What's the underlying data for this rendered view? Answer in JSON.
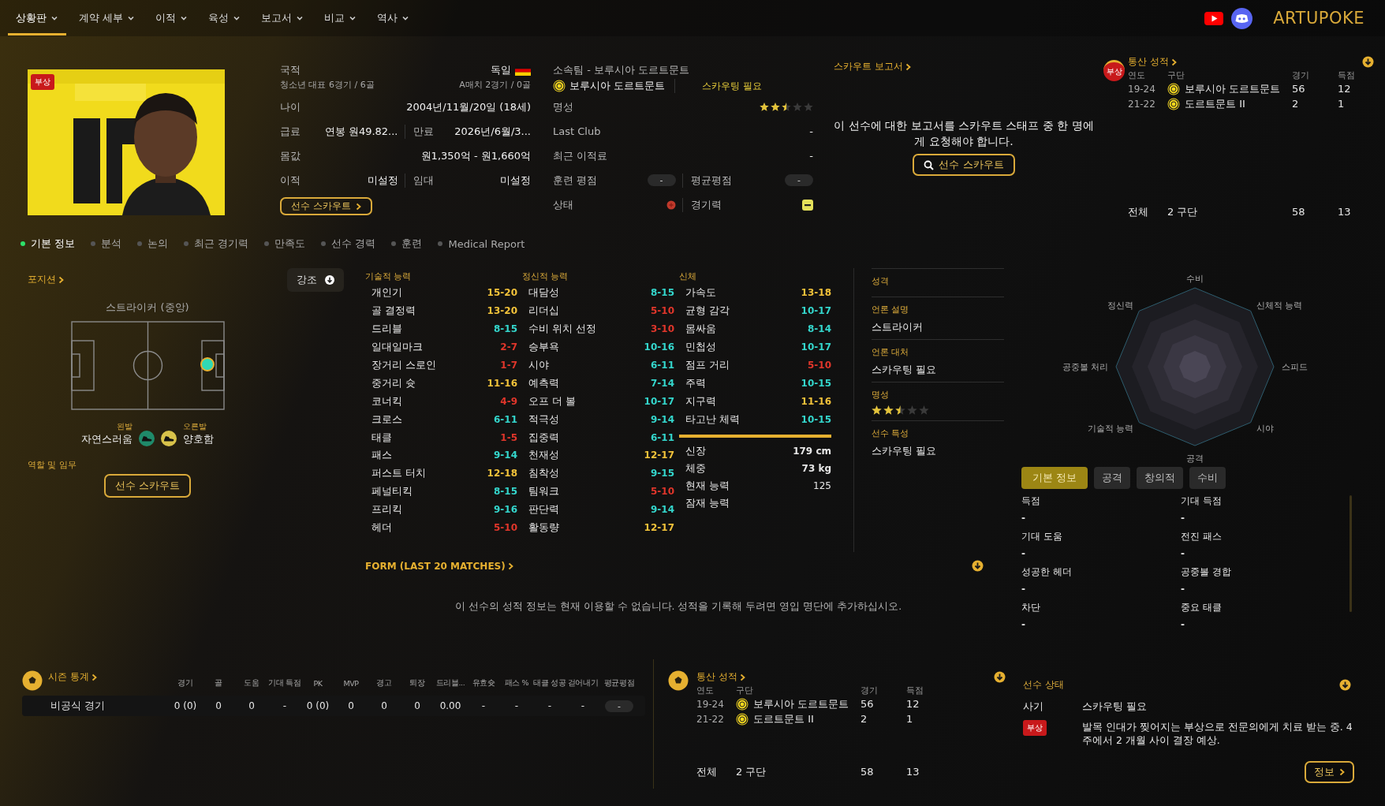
{
  "nav": {
    "items": [
      {
        "label": "상황판",
        "selected": true
      },
      {
        "label": "계약 세부",
        "selected": false
      },
      {
        "label": "이적",
        "selected": false
      },
      {
        "label": "육성",
        "selected": false
      },
      {
        "label": "보고서",
        "selected": false
      },
      {
        "label": "비교",
        "selected": false
      },
      {
        "label": "역사",
        "selected": false
      }
    ],
    "brand": "ARTUPOKE"
  },
  "photo": {
    "kind": "picture",
    "badge": "부상"
  },
  "nationality": {
    "label": "국적",
    "value": "독일",
    "youth": "청소년 대표 6경기 / 6골",
    "senior": "A매치 2경기 / 0골"
  },
  "info_left": [
    {
      "label": "나이",
      "value": "2004년/11월/20일 (18세)"
    },
    {
      "label": "급료",
      "value": "연봉 원49.82...",
      "label2": "만료",
      "value2": "2026년/6월/3..."
    },
    {
      "label": "몸값",
      "value": "원1,350억 - 원1,660억"
    },
    {
      "label": "이적",
      "value": "미설정",
      "label2": "임대",
      "value2": "미설정"
    }
  ],
  "scout_button": "선수 스카우트",
  "club": {
    "label": "소속팀 - 보루시아 도르트문트",
    "name": "보루시아 도르트문트",
    "note": "스카우팅 필요"
  },
  "info_right": [
    {
      "kind": "stars",
      "label": "명성",
      "stars": 2.5
    },
    {
      "kind": "text",
      "label": "Last Club",
      "value": "-"
    },
    {
      "kind": "text",
      "label": "최근 이적료",
      "value": "-"
    },
    {
      "kind": "pills",
      "label": "훈련 평점",
      "value": "-",
      "label2": "평균평점",
      "value2": "-"
    },
    {
      "kind": "status",
      "label": "상태",
      "label2": "경기력"
    }
  ],
  "scout_report": {
    "title": "스카우트 보고서",
    "message": "이 선수에 대한 보고서를 스카우트 스태프 중 한 명에게 요청해야 합니다.",
    "button": "선수 스카우트"
  },
  "career_top": {
    "badge": "부상",
    "title": "통산 성적",
    "columns": [
      "연도",
      "구단",
      "경기",
      "득점"
    ],
    "rows": [
      {
        "year": "19-24",
        "club": "보루시아 도르트문트",
        "apps": "56",
        "goals": "12"
      },
      {
        "year": "21-22",
        "club": "도르트문트 II",
        "apps": "2",
        "goals": "1"
      }
    ],
    "total": {
      "label": "전체",
      "clubs": "2 구단",
      "apps": "58",
      "goals": "13"
    }
  },
  "tabs": [
    {
      "label": "기본 정보",
      "selected": true
    },
    {
      "label": "분석",
      "selected": false
    },
    {
      "label": "논의",
      "selected": false
    },
    {
      "label": "최근 경기력",
      "selected": false
    },
    {
      "label": "만족도",
      "selected": false
    },
    {
      "label": "선수 경력",
      "selected": false
    },
    {
      "label": "훈련",
      "selected": false
    },
    {
      "label": "Medical Report",
      "selected": false
    }
  ],
  "position": {
    "title": "포지션",
    "role": "스트라이커 (중앙)",
    "left_foot_label": "왼발",
    "left_foot": "자연스러움",
    "right_foot_label": "오른발",
    "right_foot": "양호함",
    "duties": "역할 및 임무",
    "button": "선수 스카우트"
  },
  "attributes": {
    "highlight": "강조",
    "groups": [
      {
        "title": "기술적 능력",
        "items": [
          {
            "name": "개인기",
            "range": "15-20",
            "color": "#f2c23a"
          },
          {
            "name": "골 결정력",
            "range": "13-20",
            "color": "#f2c23a"
          },
          {
            "name": "드리블",
            "range": "8-15",
            "color": "#34d6cc"
          },
          {
            "name": "일대일마크",
            "range": "2-7",
            "color": "#e0362b"
          },
          {
            "name": "장거리 스로인",
            "range": "1-7",
            "color": "#e0362b"
          },
          {
            "name": "중거리 슛",
            "range": "11-16",
            "color": "#f2c23a"
          },
          {
            "name": "코너킥",
            "range": "4-9",
            "color": "#e0362b"
          },
          {
            "name": "크로스",
            "range": "6-11",
            "color": "#34d6cc"
          },
          {
            "name": "태클",
            "range": "1-5",
            "color": "#e0362b"
          },
          {
            "name": "패스",
            "range": "9-14",
            "color": "#34d6cc"
          },
          {
            "name": "퍼스트 터치",
            "range": "12-18",
            "color": "#f2c23a"
          },
          {
            "name": "페널티킥",
            "range": "8-15",
            "color": "#34d6cc"
          },
          {
            "name": "프리킥",
            "range": "9-16",
            "color": "#34d6cc"
          },
          {
            "name": "헤더",
            "range": "5-10",
            "color": "#e0362b"
          }
        ]
      },
      {
        "title": "정신적 능력",
        "items": [
          {
            "name": "대담성",
            "range": "8-15",
            "color": "#34d6cc"
          },
          {
            "name": "리더십",
            "range": "5-10",
            "color": "#e0362b"
          },
          {
            "name": "수비 위치 선정",
            "range": "3-10",
            "color": "#e0362b"
          },
          {
            "name": "승부욕",
            "range": "10-16",
            "color": "#34d6cc"
          },
          {
            "name": "시야",
            "range": "6-11",
            "color": "#34d6cc"
          },
          {
            "name": "예측력",
            "range": "7-14",
            "color": "#34d6cc"
          },
          {
            "name": "오프 더 볼",
            "range": "10-17",
            "color": "#34d6cc"
          },
          {
            "name": "적극성",
            "range": "9-14",
            "color": "#34d6cc"
          },
          {
            "name": "집중력",
            "range": "6-11",
            "color": "#34d6cc"
          },
          {
            "name": "천재성",
            "range": "12-17",
            "color": "#f2c23a"
          },
          {
            "name": "침착성",
            "range": "9-15",
            "color": "#34d6cc"
          },
          {
            "name": "팀워크",
            "range": "5-10",
            "color": "#e0362b"
          },
          {
            "name": "판단력",
            "range": "9-14",
            "color": "#34d6cc"
          },
          {
            "name": "활동량",
            "range": "12-17",
            "color": "#f2c23a"
          }
        ]
      },
      {
        "title": "신체",
        "items": [
          {
            "name": "가속도",
            "range": "13-18",
            "color": "#f2c23a"
          },
          {
            "name": "균형 감각",
            "range": "10-17",
            "color": "#34d6cc"
          },
          {
            "name": "몸싸움",
            "range": "8-14",
            "color": "#34d6cc"
          },
          {
            "name": "민첩성",
            "range": "10-17",
            "color": "#34d6cc"
          },
          {
            "name": "점프 거리",
            "range": "5-10",
            "color": "#e0362b"
          },
          {
            "name": "주력",
            "range": "10-15",
            "color": "#34d6cc"
          },
          {
            "name": "지구력",
            "range": "11-16",
            "color": "#f2c23a"
          },
          {
            "name": "타고난 체력",
            "range": "10-15",
            "color": "#34d6cc"
          }
        ]
      }
    ],
    "body": [
      {
        "label": "신장",
        "value": "179 cm",
        "bold": true
      },
      {
        "label": "체중",
        "value": "73 kg",
        "bold": true
      },
      {
        "label": "현재 능력",
        "value": "125",
        "bold": false
      },
      {
        "label": "잠재 능력"
      }
    ]
  },
  "personality": [
    {
      "title": "성격"
    },
    {
      "title": "언론 설명",
      "value": "스트라이커"
    },
    {
      "title": "언론 대처",
      "value": "스카우팅 필요"
    },
    {
      "title": "명성",
      "stars": 2.5
    },
    {
      "title": "선수 특성",
      "value": "스카우팅 필요"
    }
  ],
  "radar": {
    "labels": [
      "수비",
      "신체적 능력",
      "스피드",
      "시야",
      "공격",
      "기술적 능력",
      "공중볼 처리",
      "정신력"
    ]
  },
  "stat_tabs": [
    {
      "label": "기본 정보",
      "selected": true
    },
    {
      "label": "공격",
      "selected": false
    },
    {
      "label": "창의적",
      "selected": false
    },
    {
      "label": "수비",
      "selected": false
    }
  ],
  "stats": [
    {
      "label": "득점",
      "value": "-"
    },
    {
      "label": "기대 득점",
      "value": "-"
    },
    {
      "label": "기대 도움",
      "value": "-"
    },
    {
      "label": "전진 패스",
      "value": "-"
    },
    {
      "label": "성공한 헤더",
      "value": "-"
    },
    {
      "label": "공중볼 경합",
      "value": "-"
    },
    {
      "label": "차단",
      "value": "-"
    },
    {
      "label": "중요 태클",
      "value": "-"
    }
  ],
  "form": {
    "title": "FORM (LAST 20 MATCHES)",
    "message": "이 선수의 성적 정보는 현재 이용할 수 없습니다. 성적을 기록해 두려면 영입 명단에 추가하십시오."
  },
  "season_stats": {
    "title": "시즌 통계",
    "columns": [
      "경기",
      "골",
      "도움",
      "기대 득점",
      "PK",
      "MVP",
      "경고",
      "퇴장",
      "드리블...",
      "유효슛",
      "패스 %",
      "태클 성공",
      "걷어내기",
      "평균평점"
    ],
    "rows": [
      {
        "competition": "비공식 경기",
        "cells": [
          "0 (0)",
          "0",
          "0",
          "-",
          "0 (0)",
          "0",
          "0",
          "0",
          "0.00",
          "-",
          "-",
          "-",
          "-",
          "-"
        ]
      }
    ]
  },
  "career_bottom": {
    "title": "통산 성적",
    "columns": [
      "연도",
      "구단",
      "경기",
      "득점"
    ],
    "rows": [
      {
        "year": "19-24",
        "club": "보루시아 도르트문트",
        "apps": "56",
        "goals": "12"
      },
      {
        "year": "21-22",
        "club": "도르트문트 II",
        "apps": "2",
        "goals": "1"
      }
    ],
    "total": {
      "label": "전체",
      "clubs": "2 구단",
      "apps": "58",
      "goals": "13"
    }
  },
  "player_status": {
    "title": "선수 상태",
    "morale_label": "사기",
    "morale": "스카우팅 필요",
    "injury_badge": "부상",
    "injury_text": "발목 인대가 찢어지는 부상으로 전문의에게 치료 받는 중. 4 주에서 2 개월 사이 결장 예상.",
    "button": "정보"
  }
}
